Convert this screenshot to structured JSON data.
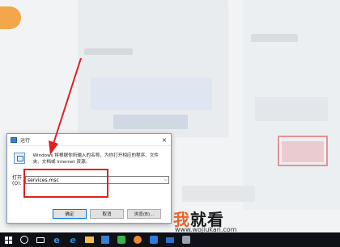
{
  "dialog": {
    "title": "运行",
    "close_glyph": "×",
    "description": "Windows 将根据你所输入的名称，为你打开相应的程序、文件夹、文档或 Internet 资源。",
    "open_label": "打开(O):",
    "command_value": "services.msc",
    "ok_label": "确定",
    "cancel_label": "取消",
    "browse_label": "浏览(B)..."
  },
  "watermark": {
    "cn_first": "我",
    "cn_rest": "就看",
    "url": "www.wojiukan.com"
  },
  "taskbar": {
    "icons": [
      "windows-start-icon",
      "search-icon",
      "task-view-icon",
      "edge-icon",
      "ie-icon",
      "folder-icon",
      "store-icon",
      "green-app-icon",
      "orange-app-icon",
      "blue-app-icon",
      "mail-icon",
      "gray-app-icon"
    ]
  },
  "colors": {
    "annotation_red": "#e02020",
    "taskbar": "#0f1116",
    "dialog_border": "#7a9ec9"
  }
}
